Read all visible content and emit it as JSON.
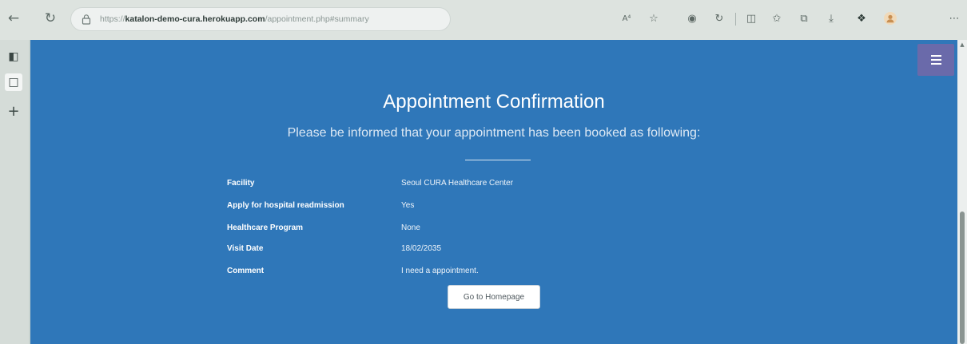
{
  "browser": {
    "url_protocol": "https://",
    "url_host": "katalon-demo-cura.herokuapp.com",
    "url_path": "/appointment.php#summary",
    "reader_mode_label": "A⁴",
    "icons": [
      "back-icon",
      "refresh-icon",
      "lock-icon",
      "read-aloud-icon",
      "favorite-icon",
      "extension-icon",
      "copilot-icon",
      "split-screen-icon",
      "favorites-bar-icon",
      "collections-icon",
      "download-icon",
      "extension-puzzle-icon",
      "profile-icon",
      "more-icon"
    ]
  },
  "sidebar": {
    "icons": [
      "tab-actions-icon",
      "page-icon",
      "new-tab-icon"
    ]
  },
  "page": {
    "title": "Appointment Confirmation",
    "subtitle": "Please be informed that your appointment has been booked as following:",
    "details": [
      {
        "label": "Facility",
        "value": "Seoul CURA Healthcare Center"
      },
      {
        "label": "Apply for hospital readmission",
        "value": "Yes"
      },
      {
        "label": "Healthcare Program",
        "value": "None"
      },
      {
        "label": "Visit Date",
        "value": "18/02/2035"
      },
      {
        "label": "Comment",
        "value": "I need a appointment."
      }
    ],
    "home_button": "Go to Homepage"
  },
  "colors": {
    "page_background": "#2f77b9",
    "menu_button": "#6a6aaa"
  }
}
